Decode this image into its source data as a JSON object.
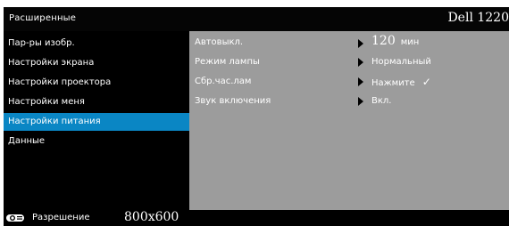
{
  "header": {
    "menu_name": "Расширенные",
    "model": "Dell 1220"
  },
  "sidebar": {
    "active_index": 4,
    "items": [
      {
        "label": "Пар-ры изобр."
      },
      {
        "label": "Настройки экрана"
      },
      {
        "label": "Настройки проектора"
      },
      {
        "label": "Настройки меня"
      },
      {
        "label": "Настройки питания"
      },
      {
        "label": "Данные"
      }
    ]
  },
  "options": [
    {
      "label": "Автовыкл.",
      "value_num": "120",
      "value_text": "мин"
    },
    {
      "label": "Режим лампы",
      "value_num": "",
      "value_text": "Нормальный"
    },
    {
      "label": "Сбр.час.лам",
      "value_num": "",
      "value_text": "Нажмите",
      "check": "✓"
    },
    {
      "label": "Звук включения",
      "value_num": "",
      "value_text": "Вкл."
    }
  ],
  "status": {
    "icon": "projector-icon",
    "label": "Разрешение",
    "value": "800x600"
  },
  "colors": {
    "active_item": "#0a86c4",
    "panel_bg": "#9c9c9c"
  }
}
